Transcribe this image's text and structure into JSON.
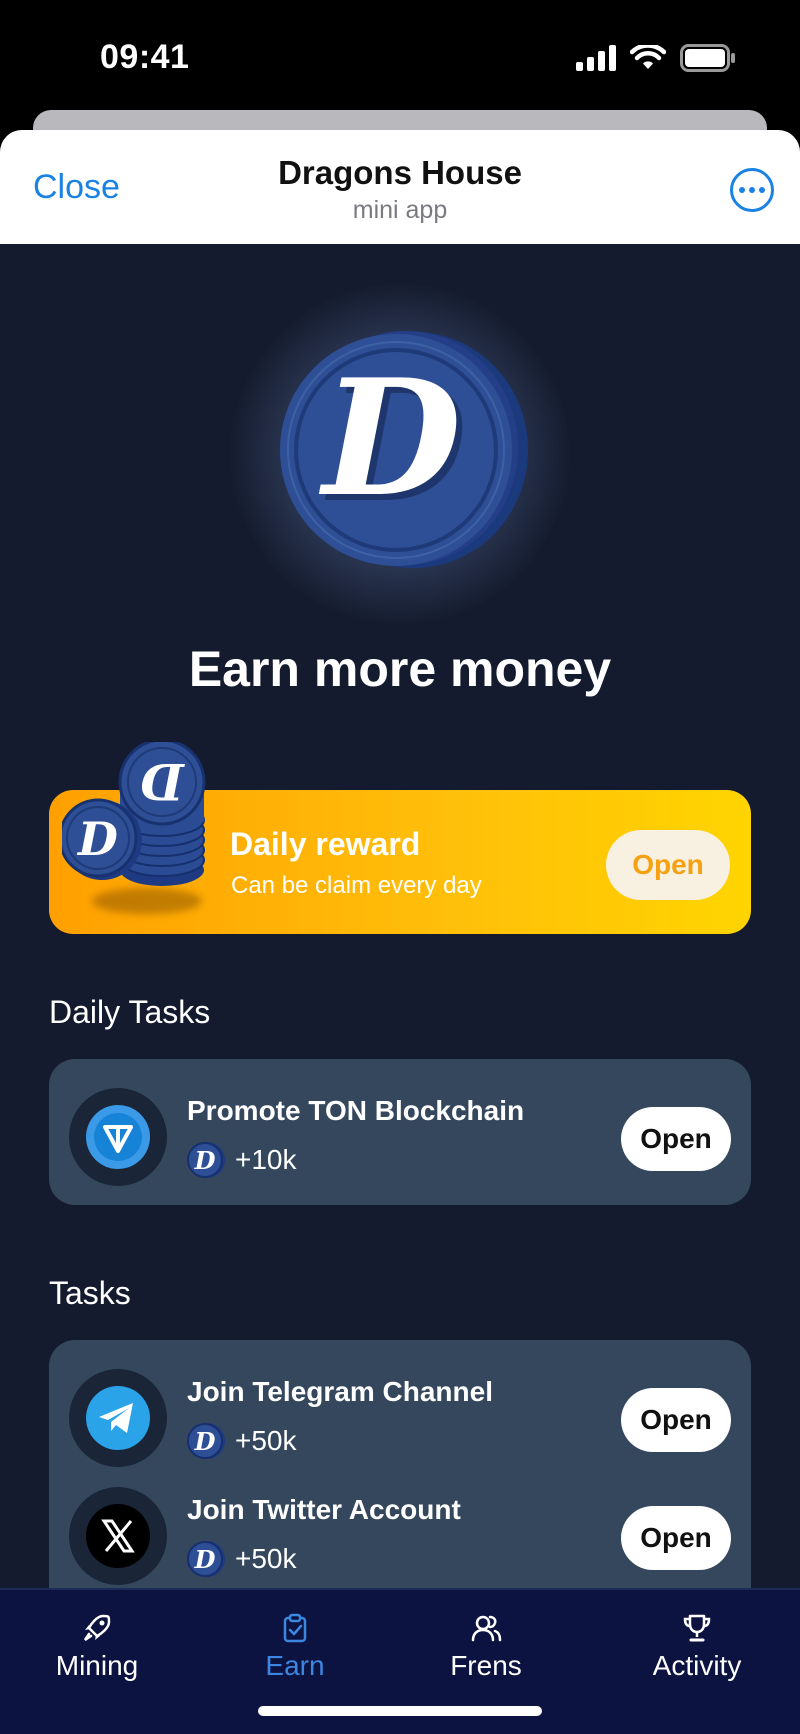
{
  "status_bar": {
    "time": "09:41"
  },
  "header": {
    "close_label": "Close",
    "title": "Dragons House",
    "subtitle": "mini app",
    "more_icon": "ellipsis-circle-icon"
  },
  "hero": {
    "coin_letter": "D",
    "headline": "Earn more money"
  },
  "daily_reward": {
    "title": "Daily reward",
    "subtitle": "Can be claim every day",
    "button_label": "Open",
    "coin_letter": "D"
  },
  "daily_tasks": {
    "section_label": "Daily Tasks",
    "items": [
      {
        "title": "Promote TON Blockchain",
        "reward": "+10k",
        "button_label": "Open",
        "icon": "ton-icon",
        "coin_letter": "D"
      }
    ]
  },
  "tasks": {
    "section_label": "Tasks",
    "items": [
      {
        "title": "Join Telegram Channel",
        "reward": "+50k",
        "button_label": "Open",
        "icon": "telegram-icon",
        "coin_letter": "D"
      },
      {
        "title": "Join Twitter Account",
        "reward": "+50k",
        "button_label": "Open",
        "icon": "x-twitter-icon",
        "coin_letter": "D"
      }
    ]
  },
  "bottom_nav": {
    "items": [
      {
        "label": "Mining",
        "icon": "rocket-icon",
        "active": false
      },
      {
        "label": "Earn",
        "icon": "clipboard-check-icon",
        "active": true
      },
      {
        "label": "Frens",
        "icon": "users-icon",
        "active": false
      },
      {
        "label": "Activity",
        "icon": "trophy-icon",
        "active": false
      }
    ]
  },
  "colors": {
    "accent_blue": "#1a82e2",
    "background": "#141b2e",
    "card": "#34475c",
    "reward_orange": "#ffa000",
    "reward_yellow": "#ffd400",
    "nav_background": "#0c1340",
    "nav_active": "#3b86e0"
  }
}
